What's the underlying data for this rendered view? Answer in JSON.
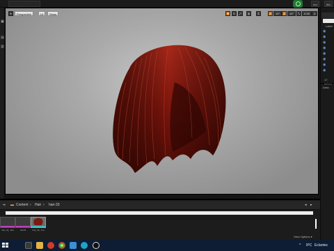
{
  "top_bar": {
    "tabs": [
      "ecc",
      "Ma"
    ]
  },
  "viewport": {
    "perspective_label": "Perspective",
    "lit_label": "Lit",
    "show_label": "Show",
    "grid_snap_value": "10°",
    "rotation_snap_value": "10°",
    "scale_snap_value": "0.25",
    "camera_speed_value": "4"
  },
  "right_panel": {
    "label_header": "Label",
    "item_count": "17 actors",
    "details_label": "Deta"
  },
  "content_browser": {
    "path": [
      "Content",
      "Hair",
      "hair-33"
    ],
    "assets": [
      {
        "caption": "hair_33_ Mat",
        "accent": "#c03fc0"
      },
      {
        "caption": "hair33",
        "accent": "#c03fc0"
      },
      {
        "caption": "hair_33_ Cut",
        "accent": "#3fb7c0"
      }
    ],
    "view_options_label": "View Options ▾"
  },
  "taskbar": {
    "locale": "IPC",
    "keyboard": "Eclantec",
    "tray_icon": "chevron-up-icon"
  },
  "colors": {
    "viewport_bg": "#a9a9a9",
    "hair_color": "#8a1a0e",
    "taskbar_bg": "#0e1d33",
    "accent_orange": "#c9751f"
  }
}
